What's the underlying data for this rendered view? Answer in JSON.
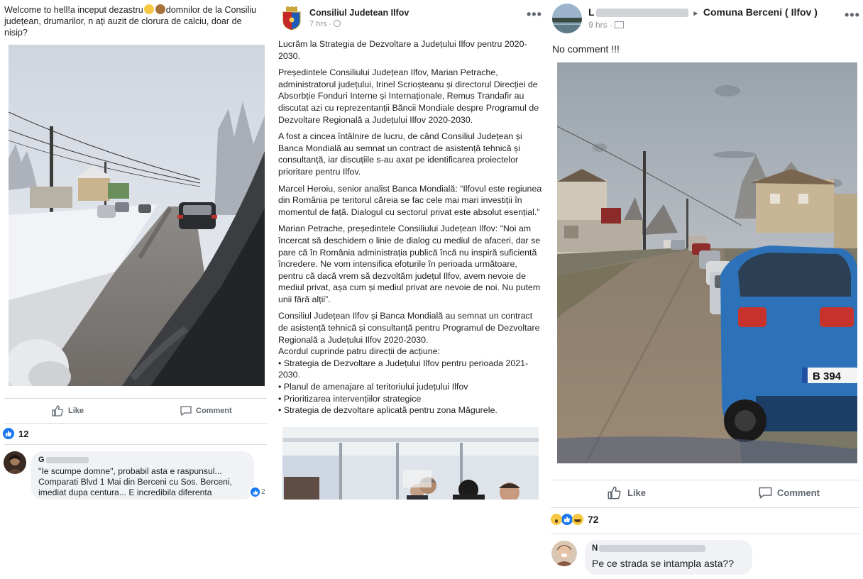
{
  "post1": {
    "text_a": "Welcome to hell!a inceput dezastru",
    "text_b": "domnilor de la Consiliu județean, drumarilor, n ați auzit de clorura de calciu, doar de nisip?",
    "like_label": "Like",
    "comment_label": "Comment",
    "reaction_count": "12",
    "comment": {
      "author": "G",
      "text": "\"Ie scumpe domne\", probabil asta e raspunsul... Comparati Blvd 1 Mai din Berceni cu Sos. Berceni, imediat dupa centura... E incredibila diferenta",
      "like_count": "2"
    }
  },
  "post2": {
    "page_name": "Consiliul Judetean Ilfov",
    "time": "7 hrs · ",
    "paragraphs": [
      "Lucrăm la Strategia de Dezvoltare a Județului Ilfov pentru 2020-2030.",
      "Președintele Consiliului Județean Ilfov, Marian Petrache, administratorul județului, Irinel Scrioșteanu și directorul Direcției de Absorbție Fonduri Interne și Internaționale, Remus Trandafir au discutat azi cu reprezentanții Băncii Mondiale despre Programul de Dezvoltare Regională a Județului Ilfov 2020-2030.",
      "A fost a cincea întâlnire de lucru, de când Consiliul Județean și Banca Mondială au semnat un contract de asistență tehnică și consultanță, iar discuțiile s-au axat pe identificarea proiectelor prioritare pentru Ilfov.",
      "Marcel Heroiu, senior analist Banca Mondială: “Ilfovul este regiunea din România pe teritorul căreia se fac cele mai mari investiții în momentul de față. Dialogul cu sectorul privat este absolut esențial.”",
      "Marian Petrache, președintele Consiliului Județean Ilfov: “Noi am încercat să deschidem o linie de dialog cu mediul de afaceri, dar se pare că în România administrația publică încă nu inspiră suficientă încredere. Ne vom intensifica efoturile în perioada următoare, pentru că dacă vrem să dezvoltăm județul Ilfov, avem nevoie de mediul privat, așa cum și mediul privat are nevoie de noi. Nu putem unii fără alții”.",
      "Consiliul Județean Ilfov și Banca Mondială au semnat un contract de asistență tehnică și consultanță pentru Programul de Dezvoltare Regională a Județului Ilfov 2020-2030."
    ],
    "list_intro": "Acordul cuprinde patru direcții de acțiune:",
    "list_items": [
      "• Strategia de Dezvoltare a Județului Ilfov pentru perioada 2021-2030.",
      "• Planul de amenajare al teritoriului județului Ilfov",
      "• Prioritizarea intervențiilor strategice",
      "• Strategia de dezvoltare aplicată pentru zona Măgurele."
    ]
  },
  "post3": {
    "author": "L",
    "separator": "▸",
    "group": "Comuna Berceni ( Ilfov )",
    "time": "9 hrs · ",
    "text": "No comment !!!",
    "like_label": "Like",
    "comment_label": "Comment",
    "reaction_count": "72",
    "comment": {
      "author": "N",
      "text": "Pe ce strada se intampla asta??"
    },
    "plate": "B 394"
  },
  "more_glyph": "•••"
}
